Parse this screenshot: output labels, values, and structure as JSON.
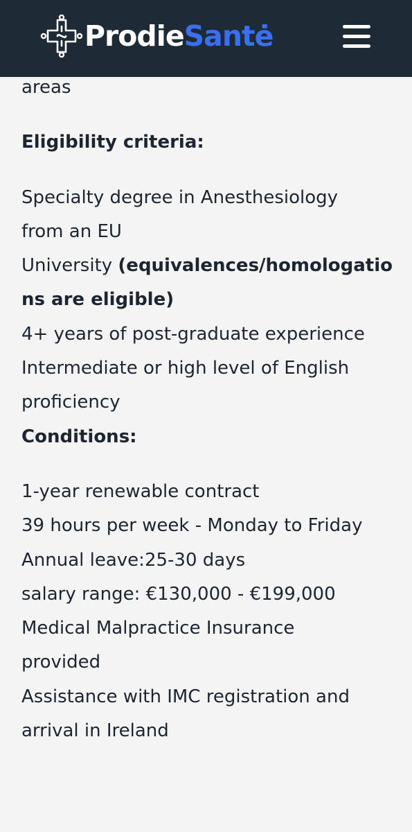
{
  "header": {
    "brand_part1": "Prodie",
    "brand_part2": "Santė",
    "logo_icon": "medical-cross-logo-icon",
    "menu_icon": "hamburger-menu-icon",
    "background_color": "#1f2a37",
    "accent_color": "#3a6ff0"
  },
  "content": {
    "top_fragment": "areas",
    "eligibility": {
      "heading": "Eligibility criteria:",
      "line1": "Specialty degree in Anesthesiology",
      "line2": "from an EU",
      "line3_plain": "University ",
      "line3_bold": "(equivalences/homologatio",
      "line4_bold": "ns are  eligible)",
      "line5": "4+ years of post-graduate experience",
      "line6": "Intermediate or high level of English",
      "line7": "proficiency"
    },
    "conditions": {
      "heading": "Conditions:",
      "line1": "1-year renewable contract",
      "line2": "39 hours per week - Monday to Friday",
      "line3": "Annual leave:25-30 days",
      "line4": "salary range: €130,000 - €199,000",
      "line5": "Medical Malpractice Insurance",
      "line6": "provided",
      "line7": "Assistance with IMC registration and",
      "line8": "arrival in Ireland"
    }
  }
}
